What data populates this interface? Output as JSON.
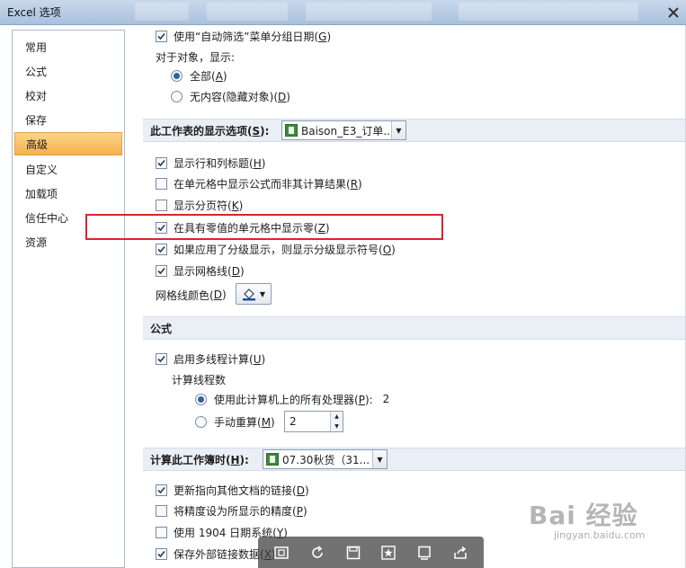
{
  "window": {
    "title": "Excel 选项"
  },
  "sidebar": {
    "items": [
      {
        "label": "常用",
        "active": false
      },
      {
        "label": "公式",
        "active": false
      },
      {
        "label": "校对",
        "active": false
      },
      {
        "label": "保存",
        "active": false
      },
      {
        "label": "高级",
        "active": true
      },
      {
        "label": "自定义",
        "active": false
      },
      {
        "label": "加载项",
        "active": false
      },
      {
        "label": "信任中心",
        "active": false
      },
      {
        "label": "资源",
        "active": false
      }
    ]
  },
  "top_options": {
    "autofilter_group": {
      "label": "使用“自动筛选”菜单分组日期(",
      "key": "G",
      "end": ")",
      "checked": true
    },
    "objects_label": "对于对象，显示:",
    "show_all": {
      "label": "全部(",
      "key": "A",
      "end": ")",
      "selected": true
    },
    "show_none": {
      "label": "无内容(隐藏对象)(",
      "key": "D",
      "end": ")",
      "selected": false
    }
  },
  "sheet_section": {
    "title": "此工作表的显示选项(",
    "title_key": "S",
    "title_end": "):",
    "dropdown_value": "Baison_E3_订单...",
    "options": [
      {
        "label": "显示行和列标题(",
        "key": "H",
        "end": ")",
        "checked": true
      },
      {
        "label": "在单元格中显示公式而非其计算结果(",
        "key": "R",
        "end": ")",
        "checked": false
      },
      {
        "label": "显示分页符(",
        "key": "K",
        "end": ")",
        "checked": false
      },
      {
        "label": "在具有零值的单元格中显示零(",
        "key": "Z",
        "end": ")",
        "checked": true
      },
      {
        "label": "如果应用了分级显示，则显示分级显示符号(",
        "key": "O",
        "end": ")",
        "checked": true
      },
      {
        "label": "显示网格线(",
        "key": "D",
        "end": ")",
        "checked": true
      }
    ],
    "gridline_color_label": "网格线颜色(",
    "gridline_color_key": "D",
    "gridline_color_end": ")"
  },
  "formula_section": {
    "title": "公式",
    "multithread": {
      "label": "启用多线程计算(",
      "key": "U",
      "end": ")",
      "checked": true
    },
    "threads_label": "计算线程数",
    "all_processors": {
      "label": "使用此计算机上的所有处理器(",
      "key": "P",
      "end": "):",
      "value": "2",
      "selected": true
    },
    "manual": {
      "label": "手动重算(",
      "key": "M",
      "end": ")",
      "selected": false
    },
    "manual_value": "2"
  },
  "calc_section": {
    "title": "计算此工作簿时(",
    "title_key": "H",
    "title_end": "):",
    "dropdown_value": "07.30秋货（31...",
    "options": [
      {
        "label": "更新指向其他文档的链接(",
        "key": "D",
        "end": ")",
        "checked": true
      },
      {
        "label": "将精度设为所显示的精度(",
        "key": "P",
        "end": ")",
        "checked": false
      },
      {
        "label": "使用 1904 日期系统(",
        "key": "Y",
        "end": ")",
        "checked": false
      },
      {
        "label": "保存外部链接数据(",
        "key": "X",
        "end": ")",
        "checked": true
      }
    ]
  },
  "watermark": {
    "text": "Bai 经验",
    "sub": "jingyan.baidu.com"
  },
  "colors": {
    "active_nav": "#f6b04c",
    "highlight": "#d9252b",
    "section_bg": "#eaeff5"
  }
}
